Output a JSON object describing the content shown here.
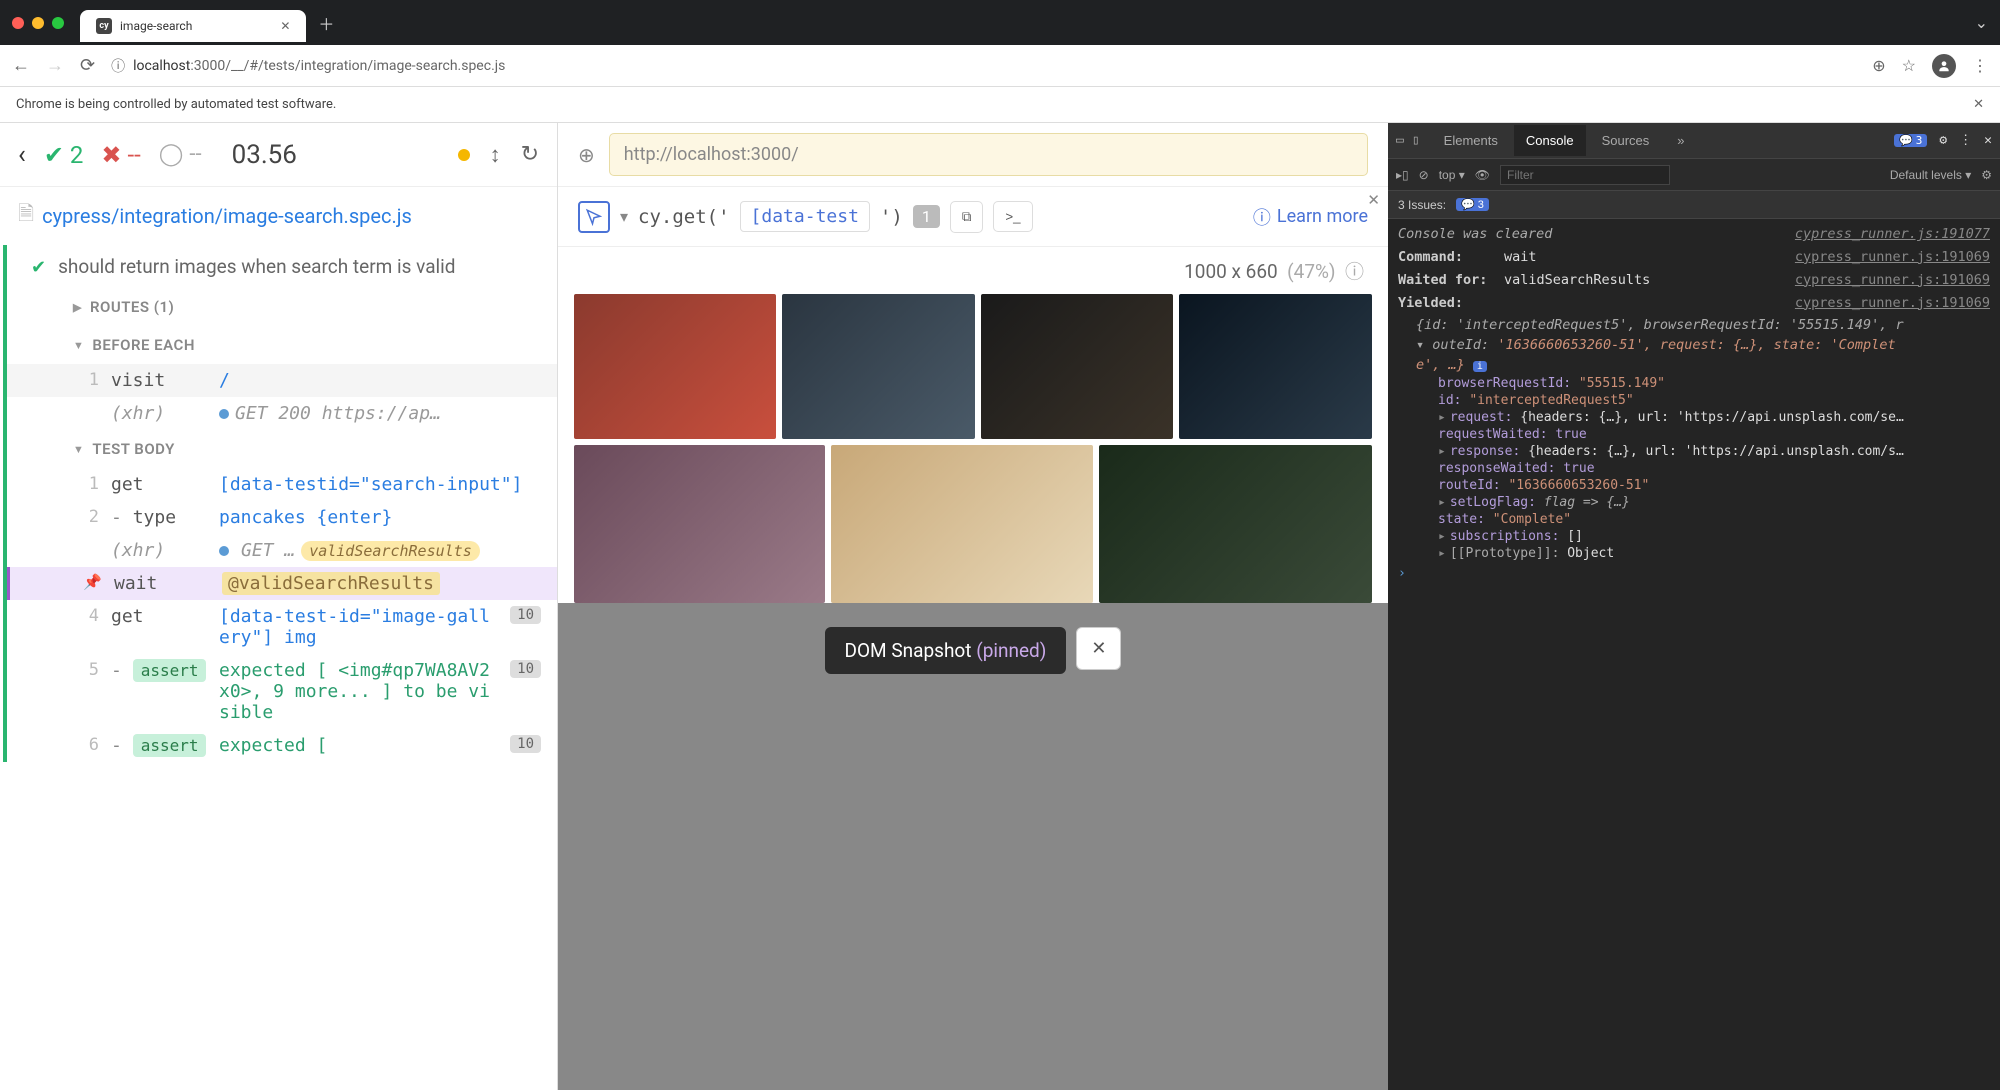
{
  "browser": {
    "tab_title": "image-search",
    "tab_icon_label": "cy",
    "url_host": "localhost",
    "url_path": ":3000/__/#/tests/integration/image-search.spec.js",
    "automation_banner": "Chrome is being controlled by automated test software."
  },
  "cypress": {
    "pass_count": "2",
    "fail_count": "--",
    "pending_count": "--",
    "duration": "03.56",
    "spec_path": "cypress/integration/image-search.spec.js",
    "test_title": "should return images when search term is valid",
    "routes_header": "ROUTES (1)",
    "before_each_header": "BEFORE EACH",
    "test_body_header": "TEST BODY",
    "commands": {
      "visit_num": "1",
      "visit_name": "visit",
      "visit_arg": "/",
      "xhr1_label": "(xhr)",
      "xhr1_text": "GET 200 https://ap…",
      "get1_num": "1",
      "get1_name": "get",
      "get1_arg": "[data-testid=\"search-input\"]",
      "type_num": "2",
      "type_name": "type",
      "type_arg": "pancakes {enter}",
      "xhr2_label": "(xhr)",
      "xhr2_text": "GET …",
      "xhr2_alias": "validSearchResults",
      "wait_name": "wait",
      "wait_arg": "@validSearchResults",
      "get3_num": "4",
      "get3_name": "get",
      "get3_arg": "[data-test-id=\"image-gallery\"] img",
      "get3_count": "10",
      "assert5_num": "5",
      "assert_label": "assert",
      "assert5_arg": "expected [ <img#qp7WA8AV2x0>, 9 more... ] to be visible",
      "assert5_count": "10",
      "assert6_num": "6",
      "assert6_arg": "expected [",
      "assert6_count": "10"
    }
  },
  "preview": {
    "url": "http://localhost:3000/",
    "selector_prefix": "cy.get('",
    "selector_value": "[data-test",
    "selector_suffix": "')",
    "selector_count": "1",
    "learn_more": "Learn more",
    "dimensions": "1000 x 660",
    "scale": "(47%)",
    "snapshot_label": "DOM Snapshot",
    "snapshot_pinned": "(pinned)"
  },
  "devtools": {
    "tabs": {
      "elements": "Elements",
      "console": "Console",
      "sources": "Sources"
    },
    "msg_count": "3",
    "filter_top": "top",
    "filter_placeholder": "Filter",
    "levels": "Default levels",
    "issues_label": "3 Issues:",
    "issues_count": "3",
    "console_cleared": "Console was cleared",
    "link1": "cypress_runner.js:191077",
    "link2": "cypress_runner.js:191069",
    "link3": "cypress_runner.js:191069",
    "link4": "cypress_runner.js:191069",
    "row_command_label": "Command:",
    "row_command_val": "wait",
    "row_waited_label": "Waited for:",
    "row_waited_val": "validSearchResults",
    "row_yielded_label": "Yielded:",
    "obj_line1": "{id: 'interceptedRequest5', browserRequestId: '55515.149', r",
    "obj_line2_key": "outeId:",
    "obj_line2_val": "'1636660653260-51', request: {…}, state: 'Complet",
    "obj_line3": "e', …}",
    "props": {
      "browserRequestId_k": "browserRequestId:",
      "browserRequestId_v": "\"55515.149\"",
      "id_k": "id:",
      "id_v": "\"interceptedRequest5\"",
      "request_k": "request:",
      "request_v": "{headers: {…}, url: 'https://api.unsplash.com/se…",
      "requestWaited_k": "requestWaited:",
      "requestWaited_v": "true",
      "response_k": "response:",
      "response_v": "{headers: {…}, url: 'https://api.unsplash.com/s…",
      "responseWaited_k": "responseWaited:",
      "responseWaited_v": "true",
      "routeId_k": "routeId:",
      "routeId_v": "\"1636660653260-51\"",
      "setLogFlag_k": "setLogFlag:",
      "setLogFlag_v": "flag => {…}",
      "state_k": "state:",
      "state_v": "\"Complete\"",
      "subscriptions_k": "subscriptions:",
      "subscriptions_v": "[]",
      "prototype_k": "[[Prototype]]:",
      "prototype_v": "Object"
    }
  }
}
